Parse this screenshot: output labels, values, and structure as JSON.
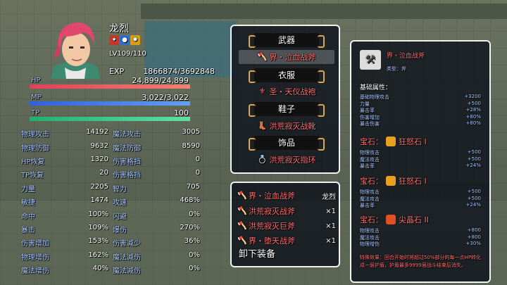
{
  "actor": {
    "name": "龙烈",
    "level": "LV109/110",
    "exp_label": "EXP",
    "exp_value": "1866874/3692848",
    "hp_label": "HP",
    "hp_value": "24,899/24,899",
    "hp_ratio": 1.0,
    "mp_label": "MP",
    "mp_value": "3,022/3,022",
    "mp_ratio": 1.0,
    "tp_label": "TP",
    "tp_value": "100",
    "tp_ratio": 1.0,
    "state_icons": [
      "status-icon-red",
      "status-icon-blue",
      "status-icon-gold"
    ]
  },
  "params": [
    {
      "l_name": "物理攻击",
      "l_val": "14192",
      "r_name": "魔法攻击",
      "r_val": "3005"
    },
    {
      "l_name": "物理防御",
      "l_val": "9632",
      "r_name": "魔法防御",
      "r_val": "8590"
    },
    {
      "l_name": "HP恢复",
      "l_val": "1320",
      "r_name": "伤害格挡",
      "r_val": "0"
    },
    {
      "l_name": "TP恢复",
      "l_val": "20",
      "r_name": "伤害格挡",
      "r_val": "0"
    },
    {
      "l_name": "力量",
      "l_val": "2205",
      "r_name": "智力",
      "r_val": "705"
    },
    {
      "l_name": "敏捷",
      "l_val": "1474",
      "r_name": "攻速",
      "r_val": "468%"
    },
    {
      "l_name": "命中",
      "l_val": "100%",
      "r_name": "闪避",
      "r_val": "0%"
    },
    {
      "l_name": "暴击",
      "l_val": "109%",
      "r_name": "爆伤",
      "r_val": "270%"
    },
    {
      "l_name": "伤害增加",
      "l_val": "153%",
      "r_name": "伤害减少",
      "r_val": "36%"
    },
    {
      "l_name": "物理增伤",
      "l_val": "162%",
      "r_name": "魔法减伤",
      "r_val": "0%"
    },
    {
      "l_name": "魔法增伤",
      "l_val": "40%",
      "r_name": "魔法减伤",
      "r_val": "0%"
    }
  ],
  "equip": {
    "weapon_label": "武器",
    "weapon_item": "界・泣血战斧",
    "armor_label": "衣服",
    "armor_item": "圣・天仪战袍",
    "shoes_label": "鞋子",
    "shoes_item": "洪荒寂灭战靴",
    "acc_label": "饰品",
    "acc_item": "洪荒寂灭指环"
  },
  "candidates": [
    {
      "name": "界・泣血战斧",
      "qty": "龙烈"
    },
    {
      "name": "洪荒寂灭战斧",
      "qty": "×1"
    },
    {
      "name": "洪荒寂灭巨斧",
      "qty": "×1"
    },
    {
      "name": "界・堕天战斧",
      "qty": "×1"
    }
  ],
  "unequip_label": "卸下装备",
  "detail": {
    "name": "界・泣血战斧",
    "type": "类型：斧",
    "base_title": "基础属性：",
    "base": [
      {
        "k": "基础物理攻击",
        "v": "+3200"
      },
      {
        "k": "力量",
        "v": "+500"
      },
      {
        "k": "暴击率",
        "v": "+28%"
      },
      {
        "k": "伤害增加",
        "v": "+80%"
      },
      {
        "k": "暴击伤害",
        "v": "+80%"
      }
    ],
    "gem_label": "宝石：",
    "gems": [
      {
        "name": "狂怒石 I",
        "color": "#e8a020",
        "lines": [
          {
            "k": "物理攻击",
            "v": "+500"
          },
          {
            "k": "魔法攻击",
            "v": "+500"
          },
          {
            "k": "暴击率",
            "v": "+24%"
          }
        ]
      },
      {
        "name": "狂怒石 I",
        "color": "#e8a020",
        "lines": [
          {
            "k": "物理攻击",
            "v": "+500"
          },
          {
            "k": "魔法攻击",
            "v": "+500"
          },
          {
            "k": "暴击率",
            "v": "+24%"
          }
        ]
      },
      {
        "name": "尖晶石 II",
        "color": "#e05020",
        "lines": [
          {
            "k": "物理攻击",
            "v": "+800"
          },
          {
            "k": "魔法攻击",
            "v": "+800"
          },
          {
            "k": "物理增伤",
            "v": "+30%"
          }
        ]
      }
    ],
    "special": "特殊效果：回合开始时将超过50%部分的每一点HP转化成一层护盾，护盾最多9999层战斗结束后消失。"
  }
}
